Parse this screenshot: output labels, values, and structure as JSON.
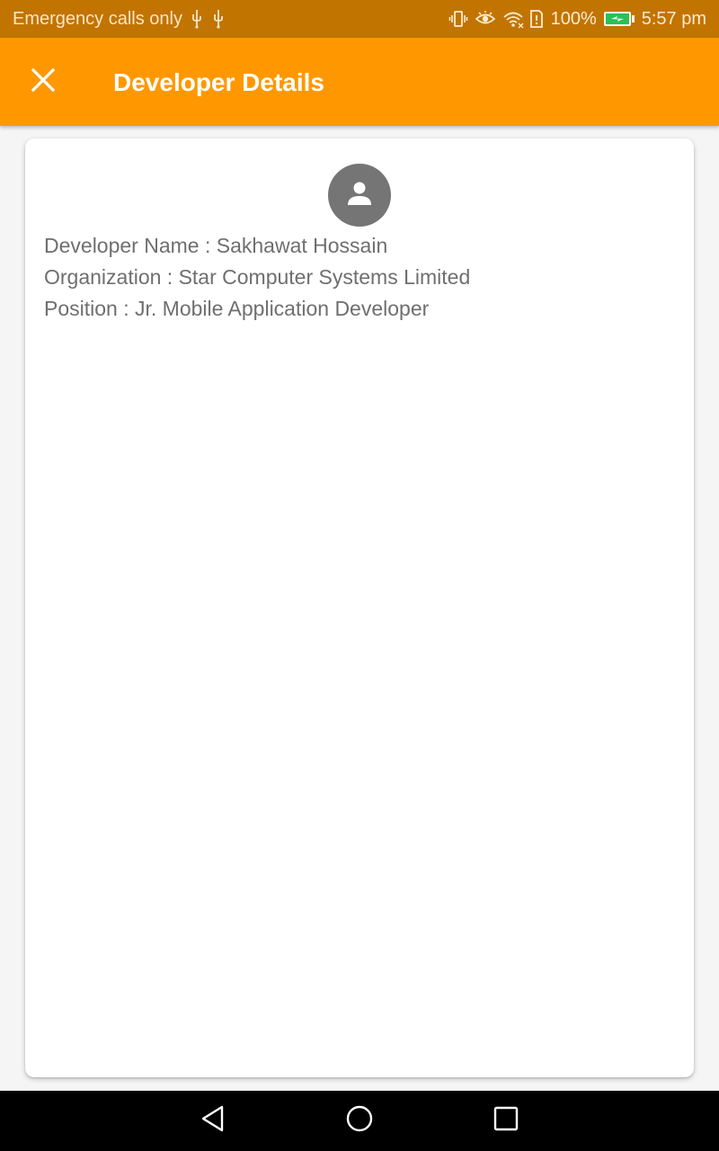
{
  "status_bar": {
    "carrier_text": "Emergency calls only",
    "battery_percent": "100%",
    "time": "5:57 pm",
    "icons": [
      "usb-icon",
      "usb-icon",
      "vibrate-icon",
      "eye-icon",
      "wifi-icon",
      "sim-alert-icon",
      "battery-charging-icon"
    ],
    "background_color": "#c27400"
  },
  "app_bar": {
    "title": "Developer Details",
    "close_icon": "close-icon",
    "background_color": "#ff9800"
  },
  "card": {
    "avatar_icon": "person-icon",
    "lines": [
      "Developer Name : Sakhawat Hossain",
      "Organization : Star Computer Systems Limited",
      "Position : Jr. Mobile Application Developer"
    ]
  },
  "nav_bar": {
    "icons": [
      "back-icon",
      "home-icon",
      "recents-icon"
    ]
  }
}
